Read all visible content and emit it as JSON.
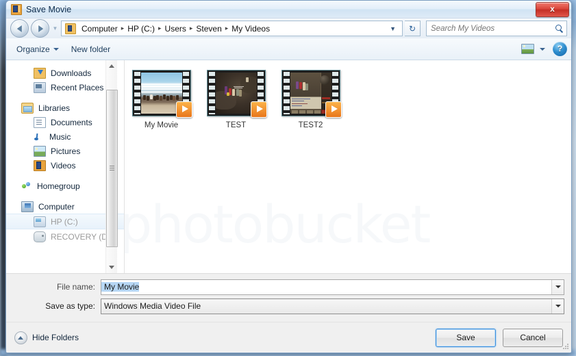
{
  "window": {
    "title": "Save Movie",
    "app_icon": "film-strip-icon",
    "close_label": "x"
  },
  "address_bar": {
    "back_tooltip": "Back",
    "forward_tooltip": "Forward",
    "folder_icon": "video-folder-icon",
    "breadcrumb": [
      "Computer",
      "HP (C:)",
      "Users",
      "Steven",
      "My Videos"
    ],
    "separator": "▸",
    "dropdown_glyph": "▼",
    "refresh_glyph": "↻"
  },
  "search": {
    "placeholder": "Search My Videos",
    "value": "",
    "icon": "search-icon"
  },
  "toolbar": {
    "organize_label": "Organize",
    "new_folder_label": "New folder",
    "view_icon": "view-layout-icon",
    "view_caret": "▼",
    "help_label": "?"
  },
  "sidebar": {
    "groups": [
      {
        "items": [
          {
            "label": "Downloads",
            "icon": "downloads-folder-icon",
            "indent": "child",
            "state": "normal"
          },
          {
            "label": "Recent Places",
            "icon": "recent-places-icon",
            "indent": "child",
            "state": "normal"
          }
        ]
      },
      {
        "items": [
          {
            "label": "Libraries",
            "icon": "libraries-icon",
            "indent": "root",
            "state": "normal"
          },
          {
            "label": "Documents",
            "icon": "documents-icon",
            "indent": "child",
            "state": "normal"
          },
          {
            "label": "Music",
            "icon": "music-icon",
            "indent": "child",
            "state": "normal"
          },
          {
            "label": "Pictures",
            "icon": "pictures-icon",
            "indent": "child",
            "state": "normal"
          },
          {
            "label": "Videos",
            "icon": "videos-icon",
            "indent": "child",
            "state": "normal"
          }
        ]
      },
      {
        "items": [
          {
            "label": "Homegroup",
            "icon": "homegroup-icon",
            "indent": "root",
            "state": "normal"
          }
        ]
      },
      {
        "items": [
          {
            "label": "Computer",
            "icon": "computer-icon",
            "indent": "root",
            "state": "normal"
          },
          {
            "label": "HP (C:)",
            "icon": "hard-drive-icon",
            "indent": "child",
            "state": "selected"
          },
          {
            "label": "RECOVERY (D:)",
            "icon": "recovery-drive-icon",
            "indent": "child",
            "state": "dim"
          }
        ]
      }
    ],
    "scrollbar": {
      "up_glyph": "▲",
      "down_glyph": "▼"
    }
  },
  "file_list": {
    "watermark": "photobucket",
    "items": [
      {
        "name": "My Movie",
        "art": "beach",
        "badge": "play-badge-icon"
      },
      {
        "name": "TEST",
        "art": "game1",
        "badge": "play-badge-icon"
      },
      {
        "name": "TEST2",
        "art": "game2",
        "badge": "play-badge-icon"
      }
    ]
  },
  "form": {
    "file_name_label": "File name:",
    "file_name_value": "My Movie",
    "save_as_type_label": "Save as type:",
    "save_as_type_value": "Windows Media Video File"
  },
  "footer": {
    "hide_folders_label": "Hide Folders",
    "save_label": "Save",
    "cancel_label": "Cancel"
  },
  "colors": {
    "accent": "#3c8ddb",
    "close_red": "#c42f25",
    "selection_blue": "#b6d6f4",
    "badge_orange": "#e8761b"
  }
}
